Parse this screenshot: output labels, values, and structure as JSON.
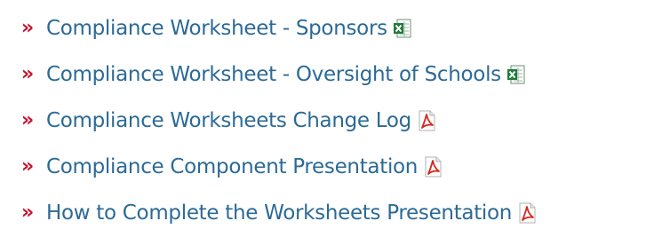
{
  "links": [
    {
      "label": "Compliance Worksheet - Sponsors",
      "icon": "excel-icon"
    },
    {
      "label": "Compliance Worksheet - Oversight of Schools",
      "icon": "excel-icon"
    },
    {
      "label": "Compliance Worksheets Change Log",
      "icon": "pdf-icon"
    },
    {
      "label": "Compliance Component Presentation",
      "icon": "pdf-icon"
    },
    {
      "label": "How to Complete the Worksheets Presentation",
      "icon": "pdf-icon"
    }
  ],
  "bullet": "»",
  "colors": {
    "link": "#2c6a96",
    "bullet": "#c8102e",
    "excel_green": "#1e7b3a",
    "pdf_red": "#d7261e"
  }
}
